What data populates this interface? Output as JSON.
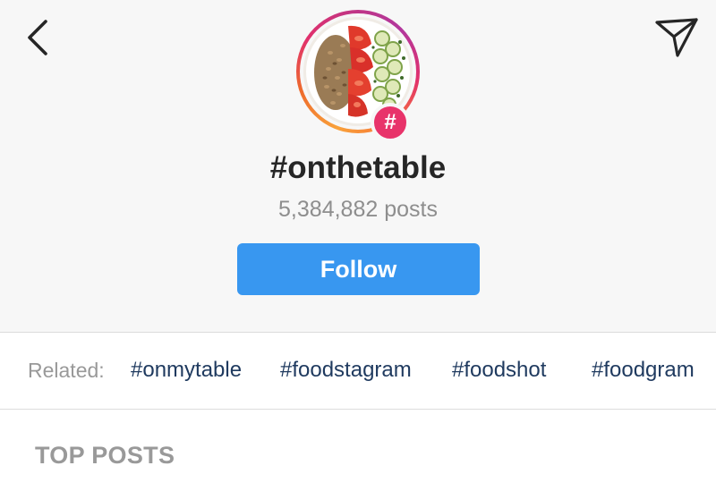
{
  "header": {
    "back_icon": "chevron-left-icon",
    "share_icon": "direct-send-icon",
    "badge_symbol": "#",
    "hashtag": "#onthetable",
    "post_count": "5,384,882 posts",
    "follow_label": "Follow"
  },
  "related": {
    "label": "Related:",
    "tags": [
      "#onmytable",
      "#foodstagram",
      "#foodshot",
      "#foodgram"
    ]
  },
  "sections": {
    "top_posts": "TOP POSTS"
  },
  "colors": {
    "follow_button": "#3897f0",
    "related_tag_text": "#1f3a5f",
    "badge": "#e8336a"
  }
}
